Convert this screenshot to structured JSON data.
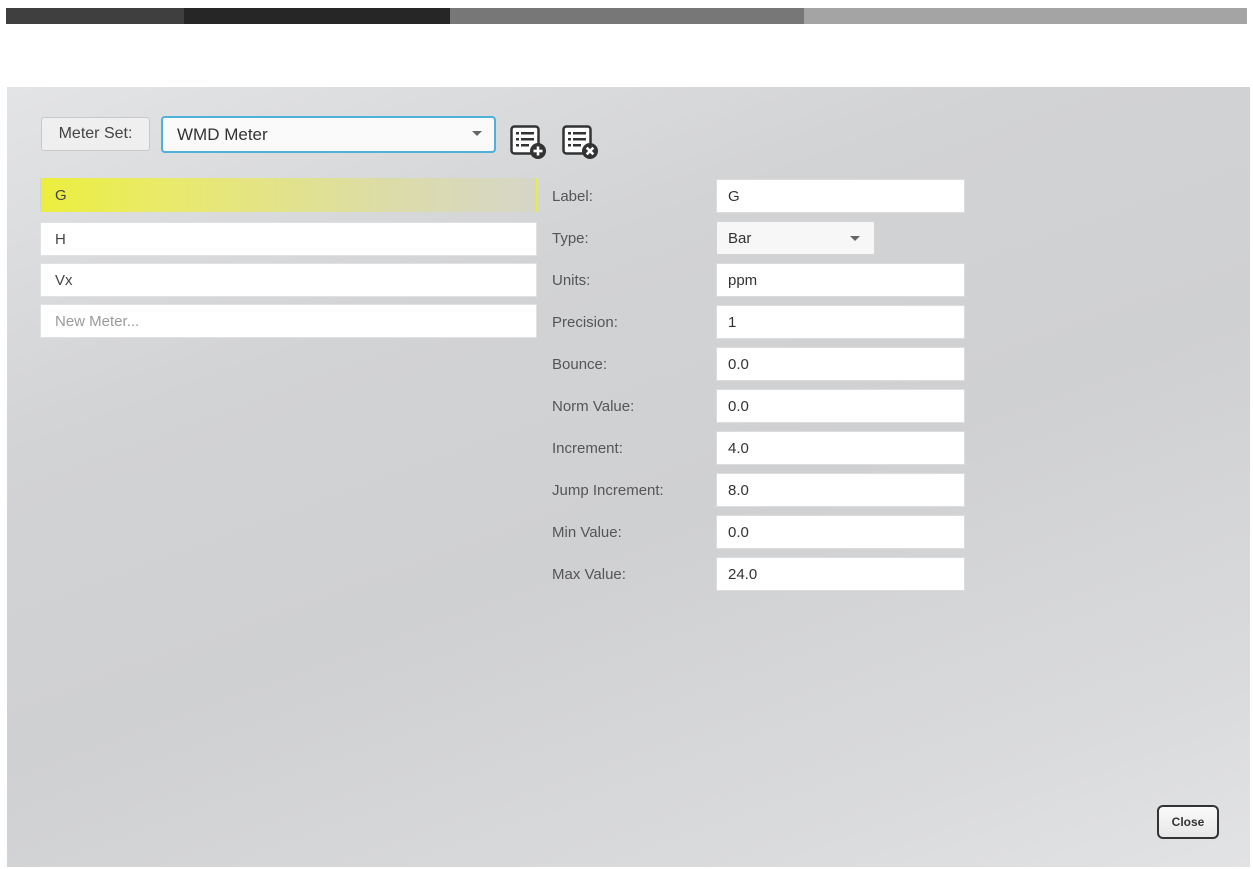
{
  "header": {
    "meter_set_label": "Meter Set:",
    "meter_set_value": "WMD Meter",
    "add_icon": "list-add-icon",
    "remove_icon": "list-remove-icon"
  },
  "meters": {
    "items": [
      {
        "label": "G",
        "selected": true
      },
      {
        "label": "H",
        "selected": false
      },
      {
        "label": "Vx",
        "selected": false
      }
    ],
    "new_placeholder": "New Meter..."
  },
  "properties": {
    "label": {
      "name": "Label:",
      "value": "G"
    },
    "type": {
      "name": "Type:",
      "value": "Bar"
    },
    "units": {
      "name": "Units:",
      "value": "ppm"
    },
    "precision": {
      "name": "Precision:",
      "value": "1"
    },
    "bounce": {
      "name": "Bounce:",
      "value": "0.0"
    },
    "norm_value": {
      "name": "Norm Value:",
      "value": "0.0"
    },
    "increment": {
      "name": "Increment:",
      "value": "4.0"
    },
    "jump_increment": {
      "name": "Jump Increment:",
      "value": "8.0"
    },
    "min_value": {
      "name": "Min Value:",
      "value": "0.0"
    },
    "max_value": {
      "name": "Max Value:",
      "value": "24.0"
    }
  },
  "footer": {
    "close_label": "Close"
  },
  "colors": {
    "selection_yellow": "#ecee3e",
    "focus_blue": "#4fb0d8",
    "panel_gray": "#d2d3d5"
  }
}
